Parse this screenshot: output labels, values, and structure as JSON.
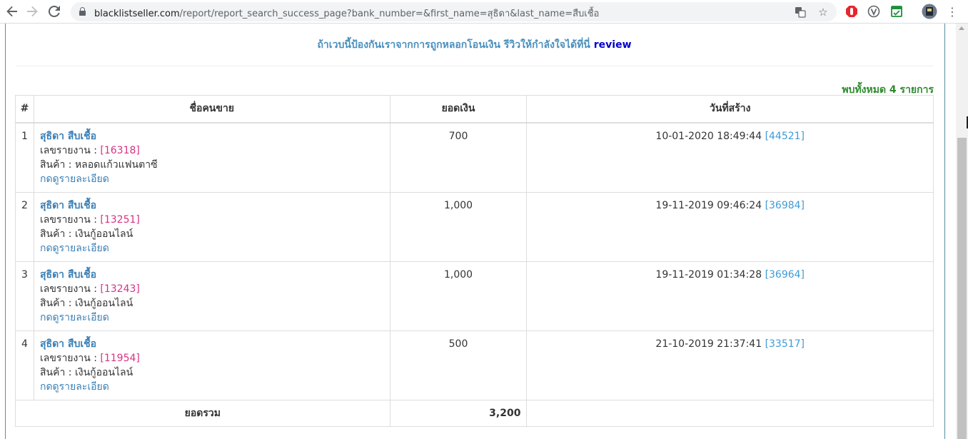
{
  "browser": {
    "url_host": "blacklistseller.com",
    "url_path": "/report/report_search_success_page?bank_number=&first_name=สุธิดา&last_name=สืบเชื้อ"
  },
  "page": {
    "review_text": "ถ้าเวบนี้ป้องกันเราจากการถูกหลอกโอนเงิน รีวิวให้กำลังใจได้ที่นี่",
    "review_link": "review",
    "found_text": "พบทั้งหมด 4 รายการ"
  },
  "table": {
    "headers": [
      "#",
      "ชื่อคนขาย",
      "ยอดเงิน",
      "วันที่สร้าง"
    ],
    "report_prefix": "เลขรายงาน : ",
    "product_prefix": "สินค้า : ",
    "detail_label": "กดดูรายละเอียด",
    "rows": [
      {
        "num": "1",
        "seller": "สุธิดา สืบเชื้อ",
        "report_no": "[16318]",
        "product": "หลอดแก้วแฟนตาซี",
        "amount": "700",
        "date": "10-01-2020 18:49:44",
        "date_id": "[44521]"
      },
      {
        "num": "2",
        "seller": "สุธิดา สืบเชื้อ",
        "report_no": "[13251]",
        "product": "เงินกู้ออนไลน์",
        "amount": "1,000",
        "date": "19-11-2019 09:46:24",
        "date_id": "[36984]"
      },
      {
        "num": "3",
        "seller": "สุธิดา สืบเชื้อ",
        "report_no": "[13243]",
        "product": "เงินกู้ออนไลน์",
        "amount": "1,000",
        "date": "19-11-2019 01:34:28",
        "date_id": "[36964]"
      },
      {
        "num": "4",
        "seller": "สุธิดา สืบเชื้อ",
        "report_no": "[11954]",
        "product": "เงินกู้ออนไลน์",
        "amount": "500",
        "date": "21-10-2019 21:37:41",
        "date_id": "[33517]"
      }
    ],
    "total_label": "ยอดรวม",
    "total_value": "3,200"
  },
  "colors": {
    "link": "#3a7fb5",
    "report_no": "#d63384",
    "found": "#2e8b2e"
  }
}
